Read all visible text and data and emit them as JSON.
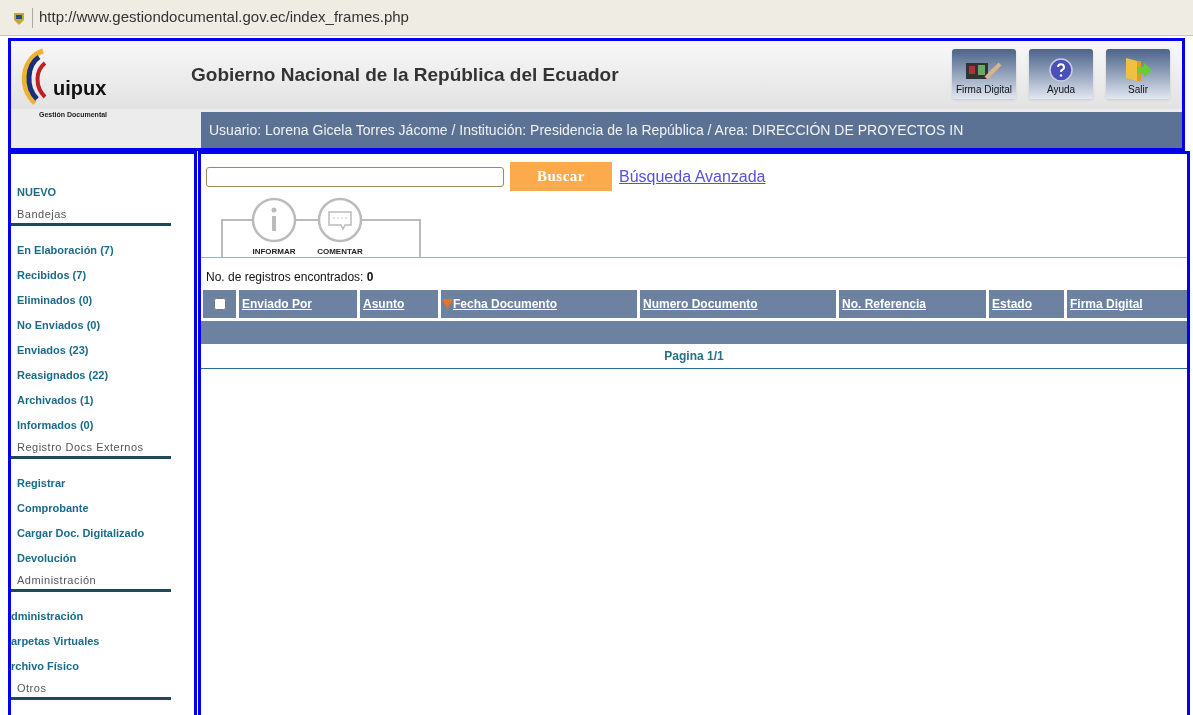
{
  "address_bar": {
    "url": "http://www.gestiondocumental.gov.ec/index_frames.php"
  },
  "header": {
    "logo_text": "uipux",
    "logo_subtitle": "Gestión Documental",
    "title": "Gobierno Nacional de la República del Ecuador",
    "buttons": [
      {
        "kind": "signature",
        "label": "Firma Digital"
      },
      {
        "kind": "help",
        "label": "Ayuda"
      },
      {
        "kind": "exit",
        "label": "Salir"
      }
    ],
    "user_info": "Usuario: Lorena Gicela Torres Jácome / Institución: Presidencia de la República / Area: DIRECCIÓN DE PROYECTOS IN"
  },
  "sidebar": {
    "items": [
      {
        "kind": "link",
        "label": "NUEVO"
      },
      {
        "kind": "heading",
        "label": "Bandejas"
      },
      {
        "kind": "link",
        "label": "En Elaboración (7)"
      },
      {
        "kind": "link",
        "label": "Recibidos (7)"
      },
      {
        "kind": "link",
        "label": "Eliminados (0)"
      },
      {
        "kind": "link",
        "label": "No Enviados (0)"
      },
      {
        "kind": "link",
        "label": "Enviados (23)"
      },
      {
        "kind": "link",
        "label": "Reasignados (22)"
      },
      {
        "kind": "link",
        "label": "Archivados (1)"
      },
      {
        "kind": "link",
        "label": "Informados (0)"
      },
      {
        "kind": "heading",
        "label": "Registro Docs Externos"
      },
      {
        "kind": "link",
        "label": "Registrar"
      },
      {
        "kind": "link",
        "label": "Comprobante"
      },
      {
        "kind": "link",
        "label": "Cargar Doc. Digitalizado"
      },
      {
        "kind": "link",
        "label": "Devolución"
      },
      {
        "kind": "heading",
        "label": "Administración"
      },
      {
        "kind": "flush",
        "label": "dministración"
      },
      {
        "kind": "flush",
        "label": "arpetas Virtuales"
      },
      {
        "kind": "flush",
        "label": "rchivo Físico"
      },
      {
        "kind": "heading",
        "label": "Otros"
      }
    ]
  },
  "search": {
    "button": "Buscar",
    "advanced_link": "Búsqueda Avanzada"
  },
  "actions": [
    {
      "kind": "info",
      "label": "INFORMAR"
    },
    {
      "kind": "comment",
      "label": "COMENTAR"
    }
  ],
  "results": {
    "label": "No. de registros encontrados: ",
    "count": "0"
  },
  "table": {
    "select_all_checked": false,
    "columns": [
      {
        "label": "Enviado Por",
        "sorted": false
      },
      {
        "label": "Asunto",
        "sorted": false
      },
      {
        "label": "Fecha Documento",
        "sorted": true
      },
      {
        "label": "Numero Documento",
        "sorted": false
      },
      {
        "label": "No. Referencia",
        "sorted": false
      },
      {
        "label": "Estado",
        "sorted": false
      },
      {
        "label": "Firma Digital",
        "sorted": false
      }
    ],
    "pagination": "Pagina 1/1"
  }
}
